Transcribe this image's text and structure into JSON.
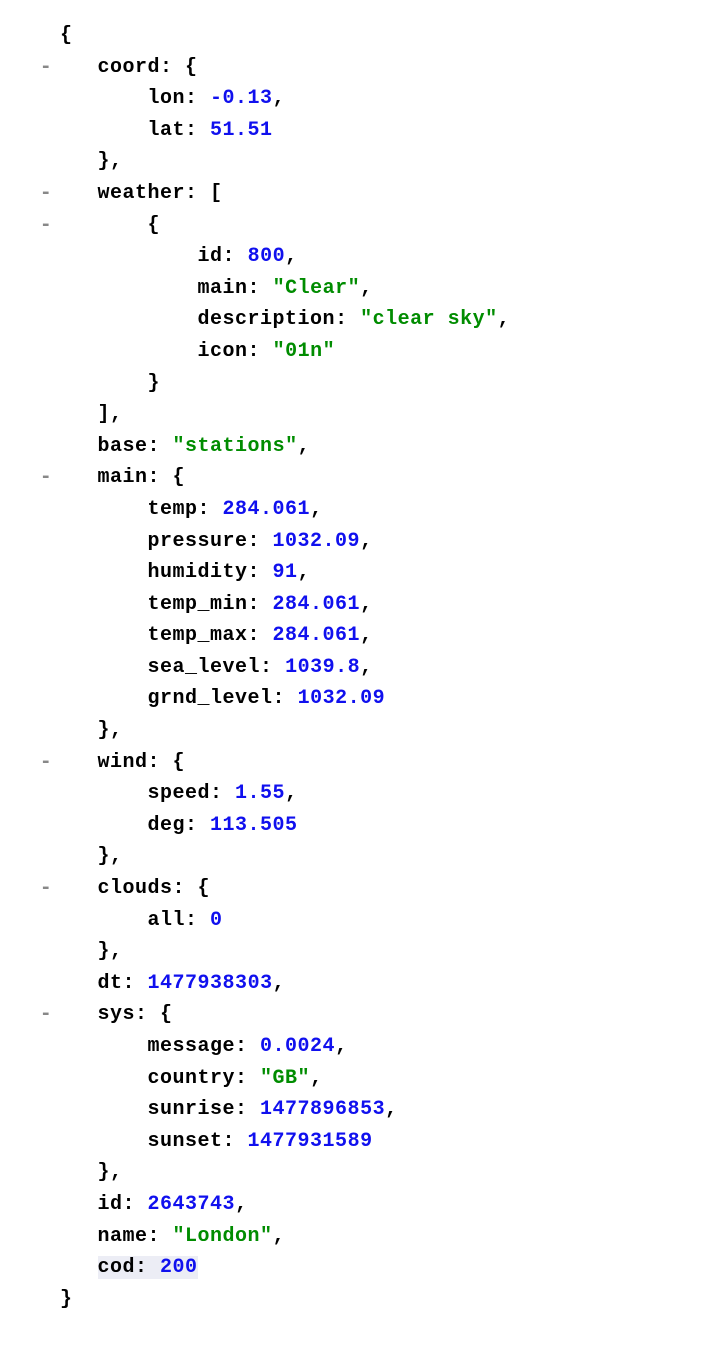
{
  "tokens": {
    "brace_open": "{",
    "brace_close": "}",
    "bracket_open": "[",
    "bracket_close": "]",
    "comma": ",",
    "colon": ": ",
    "dash": "-"
  },
  "keys": {
    "coord": "coord",
    "lon": "lon",
    "lat": "lat",
    "weather": "weather",
    "id": "id",
    "main": "main",
    "description": "description",
    "icon": "icon",
    "base": "base",
    "temp": "temp",
    "pressure": "pressure",
    "humidity": "humidity",
    "temp_min": "temp_min",
    "temp_max": "temp_max",
    "sea_level": "sea_level",
    "grnd_level": "grnd_level",
    "wind": "wind",
    "speed": "speed",
    "deg": "deg",
    "clouds": "clouds",
    "all": "all",
    "dt": "dt",
    "sys": "sys",
    "message": "message",
    "country": "country",
    "sunrise": "sunrise",
    "sunset": "sunset",
    "name": "name",
    "cod": "cod"
  },
  "values": {
    "lon": "-0.13",
    "lat": "51.51",
    "weather_id": "800",
    "weather_main": "\"Clear\"",
    "weather_description": "\"clear sky\"",
    "weather_icon": "\"01n\"",
    "base": "\"stations\"",
    "temp": "284.061",
    "pressure": "1032.09",
    "humidity": "91",
    "temp_min": "284.061",
    "temp_max": "284.061",
    "sea_level": "1039.8",
    "grnd_level": "1032.09",
    "speed": "1.55",
    "deg": "113.505",
    "all": "0",
    "dt": "1477938303",
    "message": "0.0024",
    "country": "\"GB\"",
    "sunrise": "1477896853",
    "sunset": "1477931589",
    "id": "2643743",
    "name": "\"London\"",
    "cod": "200"
  }
}
